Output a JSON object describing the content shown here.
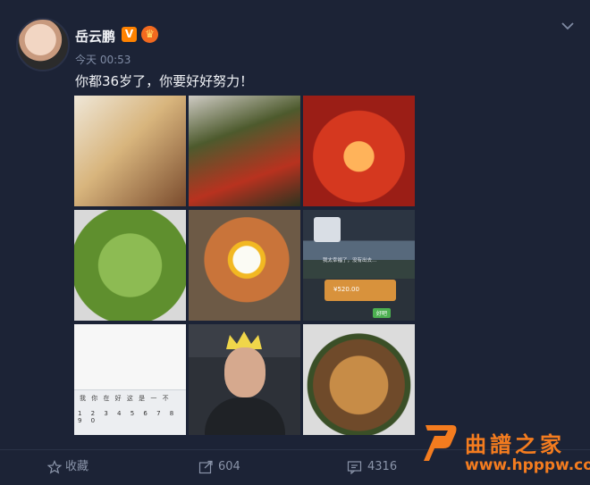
{
  "post": {
    "author": "岳云鹏",
    "verified_badge": "V",
    "time": "今天 00:53",
    "text": "你都36岁了，你要好好努力！"
  },
  "images": [
    {
      "name": "noodle-dish-image",
      "desc_icon": "food"
    },
    {
      "name": "preserved-egg-chili-image",
      "desc_icon": "food"
    },
    {
      "name": "crayfish-image",
      "desc_icon": "food"
    },
    {
      "name": "edamame-image",
      "desc_icon": "food"
    },
    {
      "name": "fried-egg-rice-image",
      "desc_icon": "food"
    },
    {
      "name": "chat-screenshot-image",
      "desc_icon": "screenshot"
    },
    {
      "name": "keyboard-screenshot-image",
      "desc_icon": "screenshot"
    },
    {
      "name": "birthday-selfie-image",
      "desc_icon": "person"
    },
    {
      "name": "fried-noodles-image",
      "desc_icon": "food"
    }
  ],
  "chat_screenshot": {
    "message": "我太幸福了，没有出去...",
    "transfer": "¥520.00",
    "ok": "好吧"
  },
  "keyboard_screenshot": {
    "candidates": "我 你 在 好 这 是 一 不",
    "numbers": "1 2 3 4 5 6 7 8 9 0"
  },
  "actions": {
    "favorite": "收藏",
    "share_count": "604",
    "comment_count": "4316"
  },
  "watermark": {
    "title": "曲譜之家",
    "url": "www.hpppw.com"
  },
  "colors": {
    "background": "#1c2336",
    "accent": "#ff8200",
    "watermark": "#f47c1f"
  }
}
